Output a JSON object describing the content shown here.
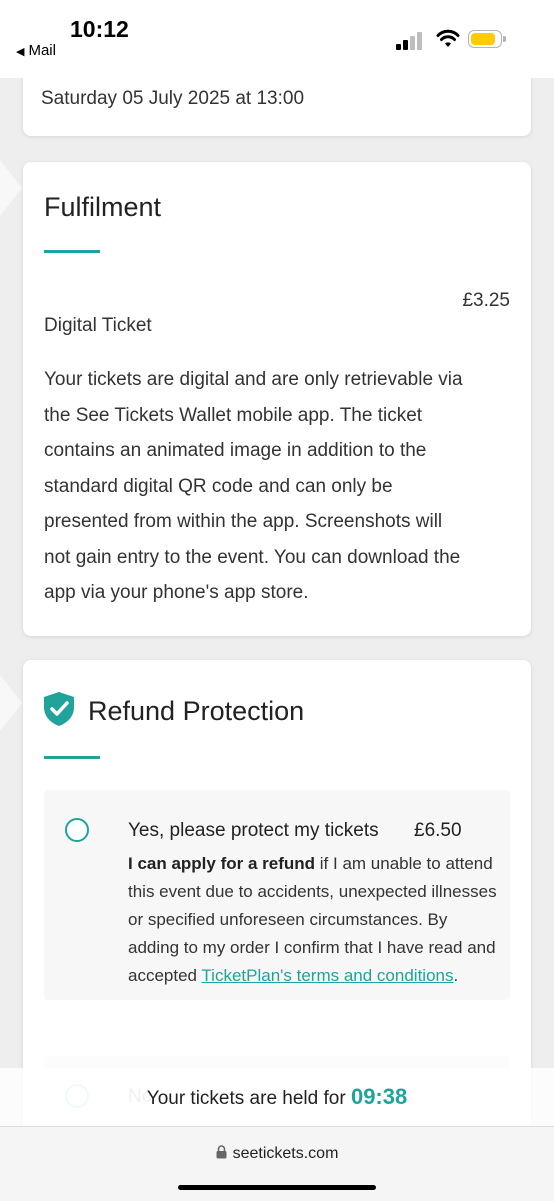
{
  "status_bar": {
    "time": "10:12",
    "back_label": "Mail",
    "battery_color": "#ffcc00"
  },
  "event_date": {
    "text": "Saturday 05 July 2025 at 13:00"
  },
  "fulfilment": {
    "title": "Fulfilment",
    "item_name": "Digital Ticket",
    "item_price": "£3.25",
    "description_lines": [
      "Your tickets are digital and are only retrievable via",
      "the See Tickets Wallet mobile app. The ticket",
      "contains an animated image in addition to the",
      "standard digital QR code and can only be",
      "presented from within the app. Screenshots will",
      "not gain entry to the event. You can download the",
      "app via your phone's app store."
    ]
  },
  "refund": {
    "title": "Refund Protection",
    "icon": "shield-check-icon",
    "option_yes": {
      "label": "Yes, please protect my tickets",
      "price": "£6.50",
      "desc_bold": "I can apply for a refund",
      "desc_rest": " if I am unable to attend this event due to accidents, unexpected illnesses or specified unforeseen circumstances. By adding to my order I confirm that I have read and accepted ",
      "link_text": "TicketPlan's terms and conditions",
      "desc_end": "."
    },
    "option_no_partial": "No"
  },
  "hold_timer": {
    "prefix": "Your tickets are held for ",
    "time": "09:38"
  },
  "browser": {
    "url": "seetickets.com"
  },
  "colors": {
    "accent": "#1fa39a",
    "background": "#eeeeee",
    "card": "#ffffff"
  }
}
